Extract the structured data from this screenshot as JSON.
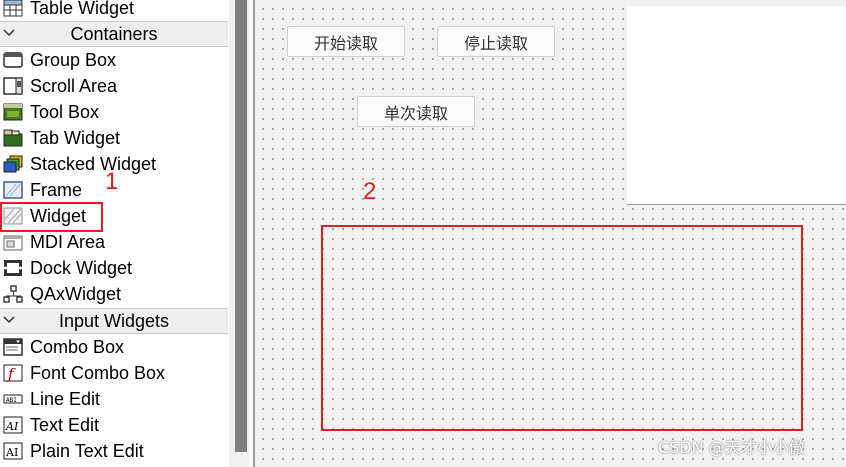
{
  "widget_box": {
    "items_top": [
      {
        "name": "table-widget",
        "label": "Table Widget",
        "icon": "table-widget-icon"
      }
    ],
    "categories": [
      {
        "label": "Containers",
        "items": [
          {
            "label": "Group Box",
            "icon": "group-box-icon"
          },
          {
            "label": "Scroll Area",
            "icon": "scroll-area-icon"
          },
          {
            "label": "Tool Box",
            "icon": "tool-box-icon"
          },
          {
            "label": "Tab Widget",
            "icon": "tab-widget-icon"
          },
          {
            "label": "Stacked Widget",
            "icon": "stacked-widget-icon"
          },
          {
            "label": "Frame",
            "icon": "frame-icon"
          },
          {
            "label": "Widget",
            "icon": "widget-icon"
          },
          {
            "label": "MDI Area",
            "icon": "mdi-area-icon"
          },
          {
            "label": "Dock Widget",
            "icon": "dock-widget-icon"
          },
          {
            "label": "QAxWidget",
            "icon": "qaxwidget-icon"
          }
        ]
      },
      {
        "label": "Input Widgets",
        "items": [
          {
            "label": "Combo Box",
            "icon": "combo-box-icon"
          },
          {
            "label": "Font Combo Box",
            "icon": "font-combo-box-icon"
          },
          {
            "label": "Line Edit",
            "icon": "line-edit-icon"
          },
          {
            "label": "Text Edit",
            "icon": "text-edit-icon"
          },
          {
            "label": "Plain Text Edit",
            "icon": "plain-text-edit-icon"
          }
        ]
      }
    ]
  },
  "form": {
    "buttons": {
      "start_read": "开始读取",
      "stop_read": "停止读取",
      "single_read": "单次读取"
    }
  },
  "annotations": {
    "one": "1",
    "two": "2"
  },
  "watermark": "CSDN @天才小小傲",
  "colors": {
    "annotation_red": "#e01f26",
    "form_background": "#f1f1f1",
    "category_background": "#efefef"
  }
}
